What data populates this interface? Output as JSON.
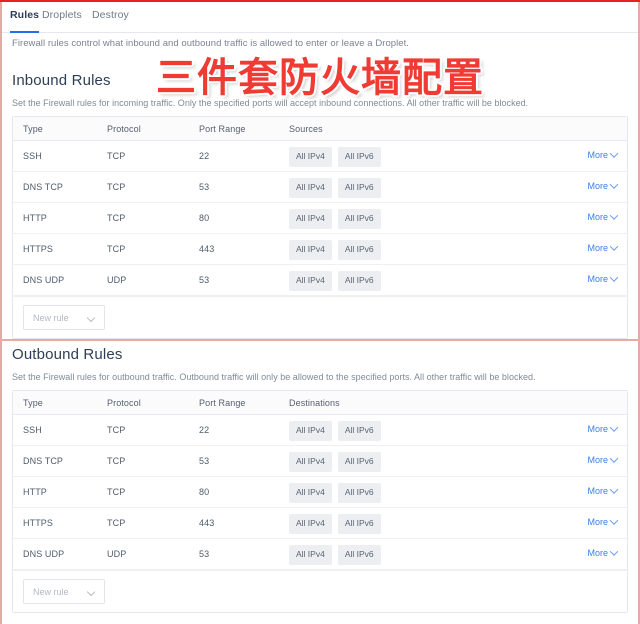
{
  "watermark": {
    "text": "三件套防火墙配置",
    "color": "#ef3b34"
  },
  "tabs": [
    {
      "label": "Rules",
      "active": true
    },
    {
      "label": "Droplets",
      "active": false
    },
    {
      "label": "Destroy",
      "active": false
    }
  ],
  "intro": "Firewall rules control what inbound and outbound traffic is allowed to enter or leave a Droplet.",
  "accent_color": "#1f6feb",
  "link_color": "#3f7ee8",
  "inbound": {
    "title": "Inbound Rules",
    "description": "Set the Firewall rules for incoming traffic. Only the specified ports will accept inbound connections. All other traffic will be blocked.",
    "columns": [
      "Type",
      "Protocol",
      "Port Range",
      "Sources"
    ],
    "rows": [
      {
        "type": "SSH",
        "protocol": "TCP",
        "port": "22",
        "tags": [
          "All IPv4",
          "All IPv6"
        ],
        "more": "More"
      },
      {
        "type": "DNS TCP",
        "protocol": "TCP",
        "port": "53",
        "tags": [
          "All IPv4",
          "All IPv6"
        ],
        "more": "More"
      },
      {
        "type": "HTTP",
        "protocol": "TCP",
        "port": "80",
        "tags": [
          "All IPv4",
          "All IPv6"
        ],
        "more": "More"
      },
      {
        "type": "HTTPS",
        "protocol": "TCP",
        "port": "443",
        "tags": [
          "All IPv4",
          "All IPv6"
        ],
        "more": "More"
      },
      {
        "type": "DNS UDP",
        "protocol": "UDP",
        "port": "53",
        "tags": [
          "All IPv4",
          "All IPv6"
        ],
        "more": "More"
      }
    ],
    "new_rule_label": "New rule"
  },
  "outbound": {
    "title": "Outbound Rules",
    "description": "Set the Firewall rules for outbound traffic. Outbound traffic will only be allowed to the specified ports. All other traffic will be blocked.",
    "columns": [
      "Type",
      "Protocol",
      "Port Range",
      "Destinations"
    ],
    "rows": [
      {
        "type": "SSH",
        "protocol": "TCP",
        "port": "22",
        "tags": [
          "All IPv4",
          "All IPv6"
        ],
        "more": "More"
      },
      {
        "type": "DNS TCP",
        "protocol": "TCP",
        "port": "53",
        "tags": [
          "All IPv4",
          "All IPv6"
        ],
        "more": "More"
      },
      {
        "type": "HTTP",
        "protocol": "TCP",
        "port": "80",
        "tags": [
          "All IPv4",
          "All IPv6"
        ],
        "more": "More"
      },
      {
        "type": "HTTPS",
        "protocol": "TCP",
        "port": "443",
        "tags": [
          "All IPv4",
          "All IPv6"
        ],
        "more": "More"
      },
      {
        "type": "DNS UDP",
        "protocol": "UDP",
        "port": "53",
        "tags": [
          "All IPv4",
          "All IPv6"
        ],
        "more": "More"
      }
    ],
    "new_rule_label": "New rule"
  }
}
